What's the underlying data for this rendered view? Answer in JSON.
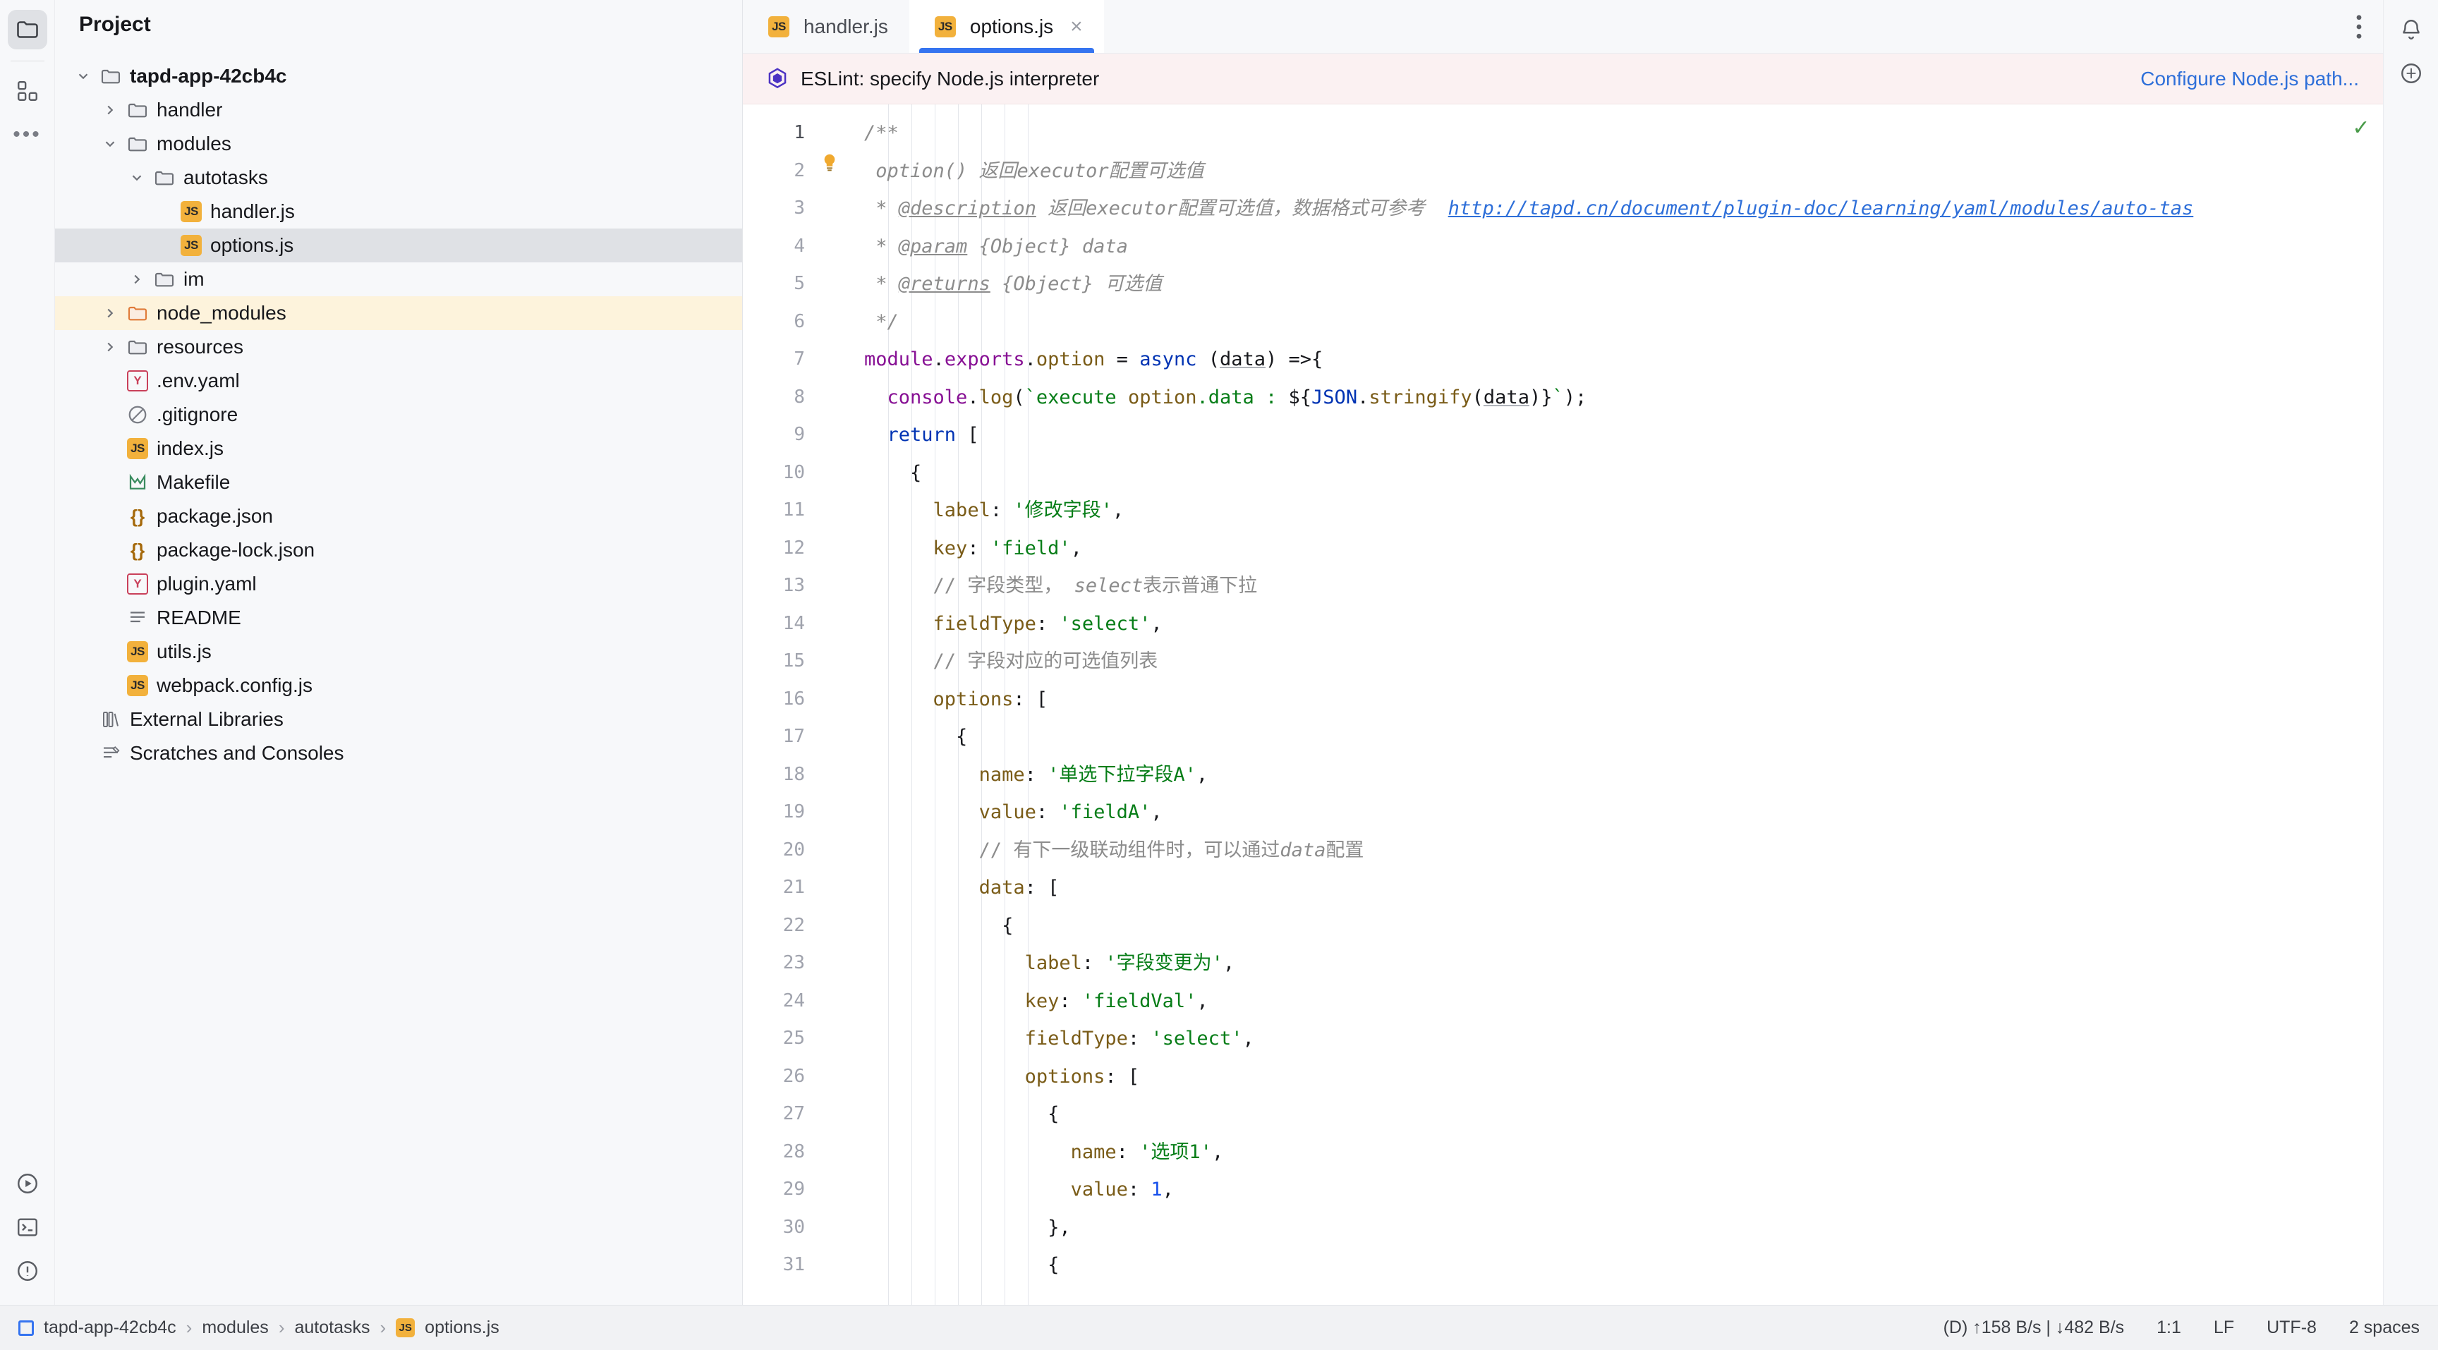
{
  "window": {
    "left_rail_icons": [
      "project-folder-icon",
      "structure-icon",
      "more-options-icon"
    ],
    "left_rail_bottom_icons": [
      "run-icon",
      "terminal-icon",
      "problems-icon"
    ],
    "right_rail_icons": [
      "notifications-bell-icon",
      "ai-assistant-icon"
    ]
  },
  "project_pane": {
    "title": "Project",
    "tree": [
      {
        "label": "tapd-app-42cb4c",
        "depth": 0,
        "icon": "folder-icon",
        "twisty": "down",
        "bold": true,
        "state": "normal"
      },
      {
        "label": "handler",
        "depth": 1,
        "icon": "folder-icon",
        "twisty": "right",
        "bold": false,
        "state": "normal"
      },
      {
        "label": "modules",
        "depth": 1,
        "icon": "folder-icon",
        "twisty": "down",
        "bold": false,
        "state": "normal"
      },
      {
        "label": "autotasks",
        "depth": 2,
        "icon": "folder-icon",
        "twisty": "down",
        "bold": false,
        "state": "normal"
      },
      {
        "label": "handler.js",
        "depth": 3,
        "icon": "js-file-icon",
        "twisty": "none",
        "bold": false,
        "state": "normal"
      },
      {
        "label": "options.js",
        "depth": 3,
        "icon": "js-file-icon",
        "twisty": "none",
        "bold": false,
        "state": "selected"
      },
      {
        "label": "im",
        "depth": 2,
        "icon": "folder-icon",
        "twisty": "right",
        "bold": false,
        "state": "normal"
      },
      {
        "label": "node_modules",
        "depth": 1,
        "icon": "folder-excluded-icon",
        "twisty": "right",
        "bold": false,
        "state": "highlight"
      },
      {
        "label": "resources",
        "depth": 1,
        "icon": "folder-icon",
        "twisty": "right",
        "bold": false,
        "state": "normal"
      },
      {
        "label": ".env.yaml",
        "depth": 1,
        "icon": "yaml-file-icon",
        "twisty": "none",
        "bold": false,
        "state": "normal"
      },
      {
        "label": ".gitignore",
        "depth": 1,
        "icon": "gitignore-file-icon",
        "twisty": "none",
        "bold": false,
        "state": "normal"
      },
      {
        "label": "index.js",
        "depth": 1,
        "icon": "js-file-icon",
        "twisty": "none",
        "bold": false,
        "state": "normal"
      },
      {
        "label": "Makefile",
        "depth": 1,
        "icon": "makefile-icon",
        "twisty": "none",
        "bold": false,
        "state": "normal"
      },
      {
        "label": "package.json",
        "depth": 1,
        "icon": "json-file-icon",
        "twisty": "none",
        "bold": false,
        "state": "normal"
      },
      {
        "label": "package-lock.json",
        "depth": 1,
        "icon": "json-file-icon",
        "twisty": "none",
        "bold": false,
        "state": "normal"
      },
      {
        "label": "plugin.yaml",
        "depth": 1,
        "icon": "yaml-file-icon",
        "twisty": "none",
        "bold": false,
        "state": "normal"
      },
      {
        "label": "README",
        "depth": 1,
        "icon": "readme-file-icon",
        "twisty": "none",
        "bold": false,
        "state": "normal"
      },
      {
        "label": "utils.js",
        "depth": 1,
        "icon": "js-file-icon",
        "twisty": "none",
        "bold": false,
        "state": "normal"
      },
      {
        "label": "webpack.config.js",
        "depth": 1,
        "icon": "js-file-icon",
        "twisty": "none",
        "bold": false,
        "state": "normal"
      },
      {
        "label": "External Libraries",
        "depth": 0,
        "icon": "libraries-icon",
        "twisty": "none",
        "bold": false,
        "state": "normal"
      },
      {
        "label": "Scratches and Consoles",
        "depth": 0,
        "icon": "scratches-icon",
        "twisty": "none",
        "bold": false,
        "state": "normal"
      }
    ]
  },
  "tabs": [
    {
      "label": "handler.js",
      "icon": "js-file-icon",
      "active": false,
      "closable": false
    },
    {
      "label": "options.js",
      "icon": "js-file-icon",
      "active": true,
      "closable": true
    }
  ],
  "tabbar": {
    "more_icon": "more-vertical-icon"
  },
  "notification": {
    "icon": "eslint-icon",
    "message": "ESLint: specify Node.js interpreter",
    "action_label": "Configure Node.js path..."
  },
  "editor": {
    "inspection_status_icon": "check-ok-icon",
    "lines": [
      {
        "n": 1,
        "current": true,
        "annot": "",
        "text": "/**"
      },
      {
        "n": 2,
        "current": false,
        "annot": "bulb",
        "text": " option() 返回executor配置可选值"
      },
      {
        "n": 3,
        "current": false,
        "annot": "",
        "text": " * @description 返回executor配置可选值，数据格式可参考  http://tapd.cn/document/plugin-doc/learning/yaml/modules/auto-tas"
      },
      {
        "n": 4,
        "current": false,
        "annot": "",
        "text": " * @param {Object} data"
      },
      {
        "n": 5,
        "current": false,
        "annot": "",
        "text": " * @returns {Object} 可选值"
      },
      {
        "n": 6,
        "current": false,
        "annot": "",
        "text": " */"
      },
      {
        "n": 7,
        "current": false,
        "annot": "",
        "text": "module.exports.option = async (data) =>{"
      },
      {
        "n": 8,
        "current": false,
        "annot": "",
        "text": "  console.log(`execute option.data : ${JSON.stringify(data)}`);"
      },
      {
        "n": 9,
        "current": false,
        "annot": "",
        "text": "  return ["
      },
      {
        "n": 10,
        "current": false,
        "annot": "",
        "text": "    {"
      },
      {
        "n": 11,
        "current": false,
        "annot": "",
        "text": "      label: '修改字段',"
      },
      {
        "n": 12,
        "current": false,
        "annot": "",
        "text": "      key: 'field',"
      },
      {
        "n": 13,
        "current": false,
        "annot": "",
        "text": "      // 字段类型， select表示普通下拉"
      },
      {
        "n": 14,
        "current": false,
        "annot": "",
        "text": "      fieldType: 'select',"
      },
      {
        "n": 15,
        "current": false,
        "annot": "",
        "text": "      // 字段对应的可选值列表"
      },
      {
        "n": 16,
        "current": false,
        "annot": "",
        "text": "      options: ["
      },
      {
        "n": 17,
        "current": false,
        "annot": "",
        "text": "        {"
      },
      {
        "n": 18,
        "current": false,
        "annot": "",
        "text": "          name: '单选下拉字段A',"
      },
      {
        "n": 19,
        "current": false,
        "annot": "",
        "text": "          value: 'fieldA',"
      },
      {
        "n": 20,
        "current": false,
        "annot": "",
        "text": "          // 有下一级联动组件时，可以通过data配置"
      },
      {
        "n": 21,
        "current": false,
        "annot": "",
        "text": "          data: ["
      },
      {
        "n": 22,
        "current": false,
        "annot": "",
        "text": "            {"
      },
      {
        "n": 23,
        "current": false,
        "annot": "",
        "text": "              label: '字段变更为',"
      },
      {
        "n": 24,
        "current": false,
        "annot": "",
        "text": "              key: 'fieldVal',"
      },
      {
        "n": 25,
        "current": false,
        "annot": "",
        "text": "              fieldType: 'select',"
      },
      {
        "n": 26,
        "current": false,
        "annot": "",
        "text": "              options: ["
      },
      {
        "n": 27,
        "current": false,
        "annot": "",
        "text": "                {"
      },
      {
        "n": 28,
        "current": false,
        "annot": "",
        "text": "                  name: '选项1',"
      },
      {
        "n": 29,
        "current": false,
        "annot": "",
        "text": "                  value: 1,"
      },
      {
        "n": 30,
        "current": false,
        "annot": "",
        "text": "                },"
      },
      {
        "n": 31,
        "current": false,
        "annot": "",
        "text": "                {"
      }
    ]
  },
  "statusbar": {
    "breadcrumb": [
      "tapd-app-42cb4c",
      "modules",
      "autotasks",
      "options.js"
    ],
    "breadcrumb_file_icon": "js-file-icon",
    "project_icon": "project-square-icon",
    "network": "(D) ↑158 B/s | ↓482 B/s",
    "caret": "1:1",
    "line_separator": "LF",
    "encoding": "UTF-8",
    "indent": "2 spaces"
  }
}
